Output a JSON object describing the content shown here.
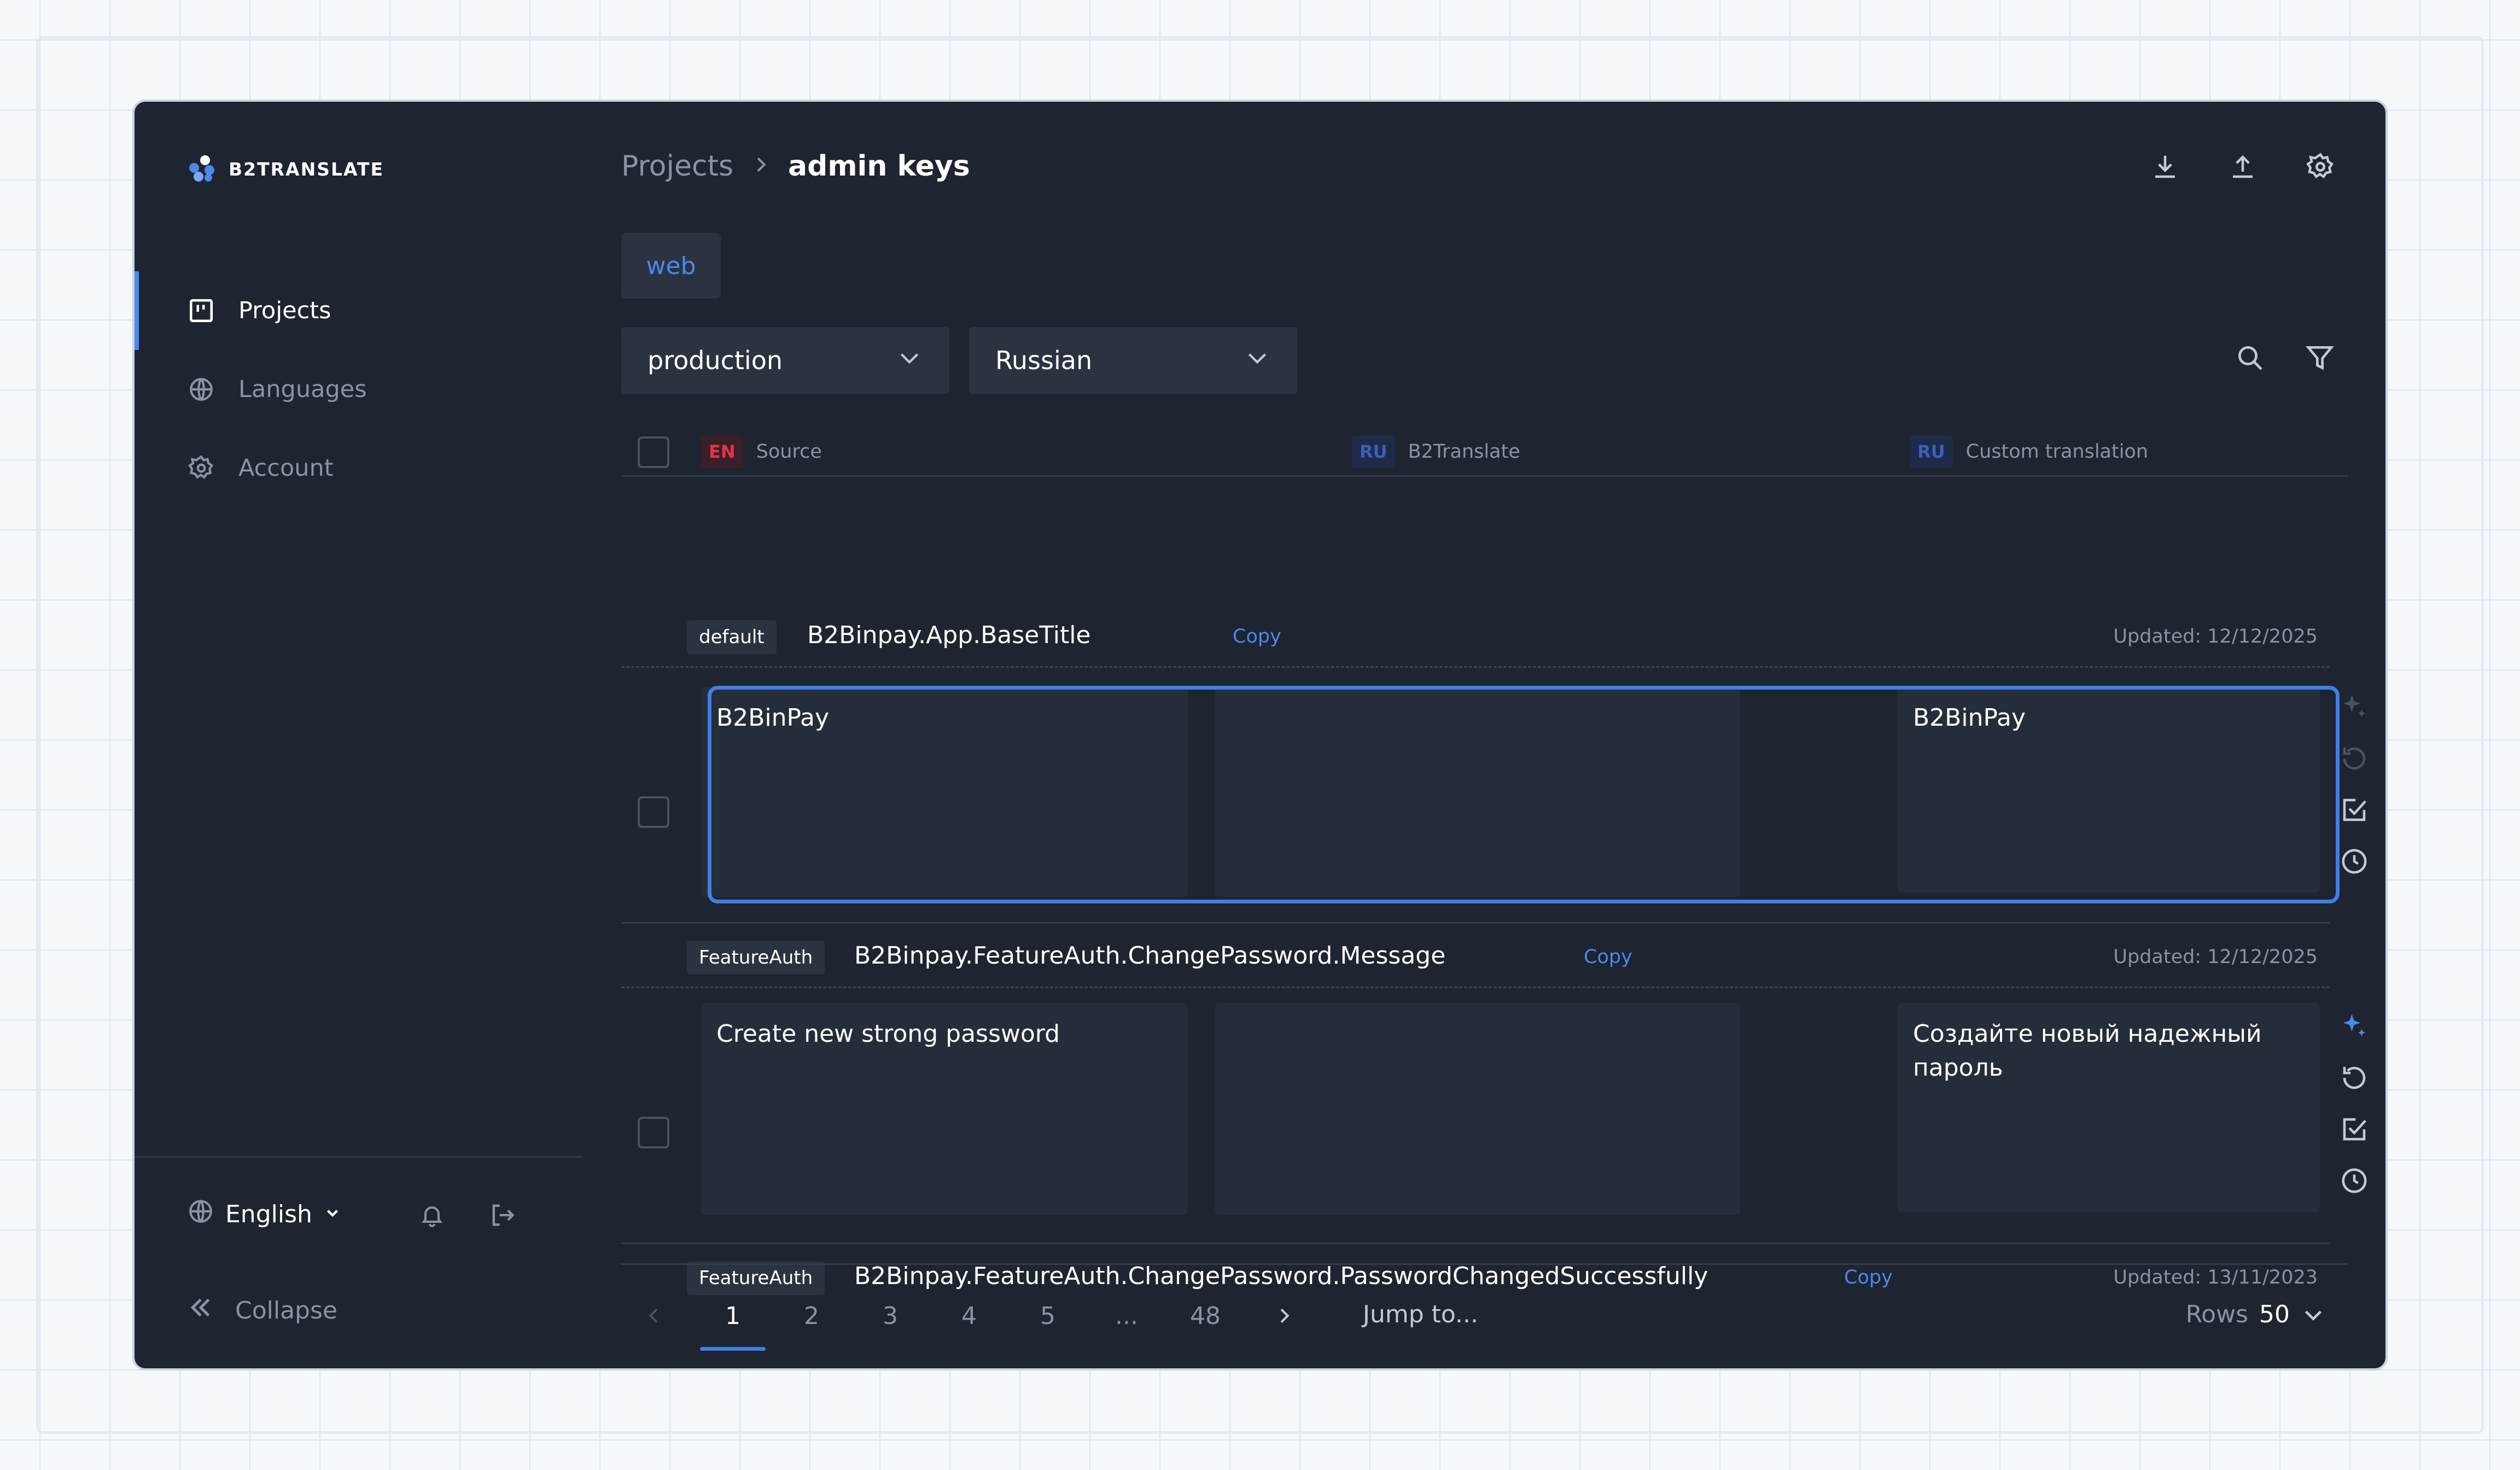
{
  "brand": {
    "name": "B2TRANSLATE"
  },
  "sidebar": {
    "items": [
      {
        "label": "Projects",
        "icon": "board-icon",
        "active": true
      },
      {
        "label": "Languages",
        "icon": "globe-icon",
        "active": false
      },
      {
        "label": "Account",
        "icon": "gear-icon",
        "active": false
      }
    ],
    "language": "English",
    "collapse_label": "Collapse"
  },
  "header": {
    "breadcrumb_parent": "Projects",
    "breadcrumb_current": "admin keys"
  },
  "tabs": [
    "web"
  ],
  "filters": {
    "environment": "production",
    "language": "Russian"
  },
  "table": {
    "columns": [
      {
        "badge": "EN",
        "label": "Source"
      },
      {
        "badge": "RU",
        "label": "B2Translate"
      },
      {
        "badge": "RU",
        "label": "Custom translation"
      }
    ],
    "copy_label": "Copy",
    "entries": [
      {
        "tag": "default",
        "key": "B2Binpay.App.BaseTitle",
        "updated": "Updated: 12/12/2025",
        "source": "B2BinPay",
        "b2translate": "",
        "custom": "B2BinPay"
      },
      {
        "tag": "FeatureAuth",
        "key": "B2Binpay.FeatureAuth.ChangePassword.Message",
        "updated": "Updated: 12/12/2025",
        "source": "Create new strong password",
        "b2translate": "",
        "custom": "Создайте новый надежный пароль"
      },
      {
        "tag": "FeatureAuth",
        "key": "B2Binpay.FeatureAuth.ChangePassword.PasswordChangedSuccessfully",
        "updated": "Updated: 13/11/2023",
        "source": "",
        "b2translate": "",
        "custom": ""
      }
    ]
  },
  "pagination": {
    "pages": [
      "1",
      "2",
      "3",
      "4",
      "5",
      "...",
      "48"
    ],
    "current": "1",
    "jump_label": "Jump to...",
    "rows_label": "Rows",
    "rows_value": "50"
  },
  "colors": {
    "accent": "#3f7ee6",
    "background": "#1e2430",
    "panel": "#262d3a",
    "en_badge": "#e0344e",
    "ru_badge": "#3c5fb8"
  }
}
